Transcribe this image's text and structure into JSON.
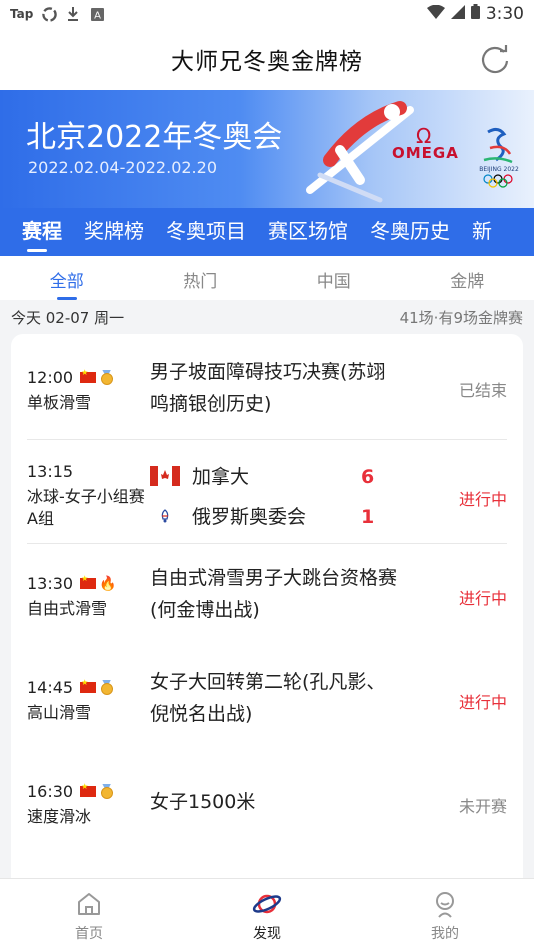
{
  "statusbar": {
    "app": "Tap",
    "time": "3:30"
  },
  "header": {
    "title": "大师兄冬奥金牌榜"
  },
  "banner": {
    "title": "北京2022年冬奥会",
    "dates": "2022.02.04-2022.02.20",
    "sponsor": "OMEGA",
    "games_logo_text": "BEIJING 2022"
  },
  "tabs": [
    {
      "label": "赛程"
    },
    {
      "label": "奖牌榜"
    },
    {
      "label": "冬奥项目"
    },
    {
      "label": "赛区场馆"
    },
    {
      "label": "冬奥历史"
    },
    {
      "label": "新"
    }
  ],
  "filters": [
    {
      "label": "全部"
    },
    {
      "label": "热门"
    },
    {
      "label": "中国"
    },
    {
      "label": "金牌"
    }
  ],
  "day": {
    "date": "今天 02-07 周一",
    "summary": "41场·有9场金牌赛"
  },
  "matches": [
    {
      "time": "12:00",
      "sport": "单板滑雪",
      "event": "男子坡面障碍技巧决赛(苏翊鸣摘银创历史)",
      "status": "已结束"
    },
    {
      "time": "13:15",
      "sport": "冰球-女子小组赛A组",
      "team1": "加拿大",
      "score1": "6",
      "team2": "俄罗斯奥委会",
      "score2": "1",
      "status": "进行中"
    },
    {
      "time": "13:30",
      "sport": "自由式滑雪",
      "event": "自由式滑雪男子大跳台资格赛(何金博出战)",
      "status": "进行中"
    },
    {
      "time": "14:45",
      "sport": "高山滑雪",
      "event": "女子大回转第二轮(孔凡影、倪悦名出战)",
      "status": "进行中"
    },
    {
      "time": "16:30",
      "sport": "速度滑冰",
      "event": "女子1500米",
      "status": "未开赛"
    }
  ],
  "bottomnav": [
    {
      "label": "首页"
    },
    {
      "label": "发现"
    },
    {
      "label": "我的"
    }
  ],
  "colors": {
    "primary": "#2f6de8",
    "live": "#e8303a",
    "omega": "#c8102e"
  }
}
